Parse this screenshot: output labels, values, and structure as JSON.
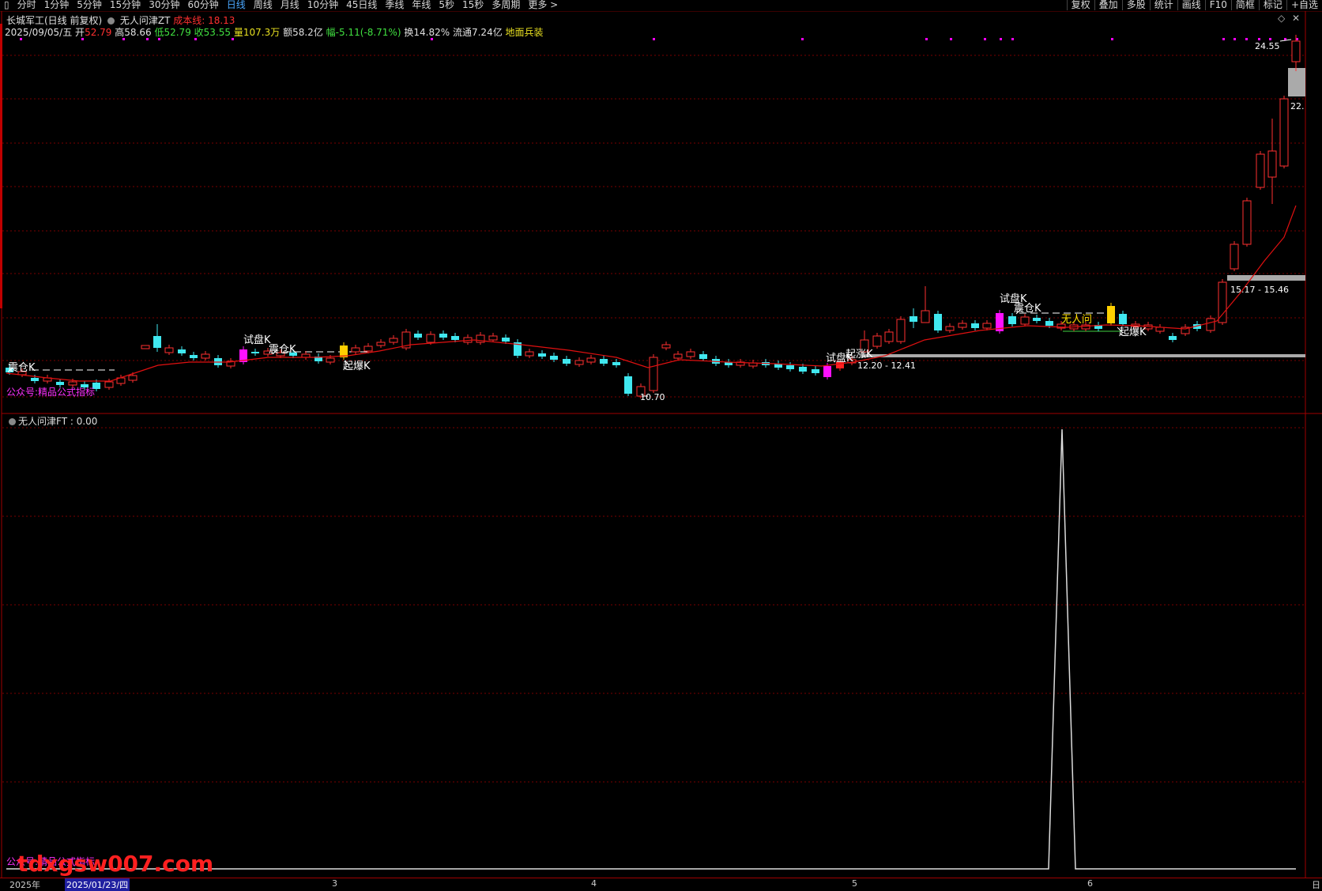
{
  "toolbar": {
    "periods": [
      "分时",
      "1分钟",
      "5分钟",
      "15分钟",
      "30分钟",
      "60分钟",
      "日线",
      "周线",
      "月线",
      "10分钟",
      "45日线",
      "季线",
      "年线",
      "5秒",
      "15秒",
      "多周期",
      "更多 >"
    ],
    "active_period": "日线",
    "right_buttons": [
      "复权",
      "叠加",
      "多股",
      "统计",
      "画线",
      "F10",
      "简框",
      "标记",
      "+自选"
    ]
  },
  "header": {
    "stock_name": "长城军工(日线 前复权)",
    "indicator": "无人问津ZT",
    "cost_line_label": "成本线: 18.13",
    "date": "2025/09/05/五",
    "open_label": "开",
    "open": "52.79",
    "high_label": "高",
    "high": "58.66",
    "low_label": "低",
    "low": "52.79",
    "close_label": "收",
    "close": "53.55",
    "volume_label": "量",
    "volume": "107.3万",
    "amount_label": "额",
    "amount": "58.2亿",
    "change_label": "幅",
    "change": "-5.11(-8.71%)",
    "turnover_label": "换",
    "turnover": "14.82%",
    "float_label": "流通",
    "float": "7.24亿",
    "sector": "地面兵装"
  },
  "annotations": {
    "cangk_1": "震仓K",
    "shipan_1": "试盘K",
    "cangk_2": "震仓K",
    "qibao_1": "起爆K",
    "low_mark": "10.70",
    "shipan_2": "试盘K",
    "qizhang": "起涨K",
    "range_1": "12.20 - 12.41",
    "shipan_3": "试盘K",
    "cangk_3": "震仓K",
    "wurenwen": "无人问",
    "qibao_2": "起爆K",
    "range_2": "15.17 - 15.46",
    "high_mark": "24.55",
    "price_22": "22.",
    "pubtext": "公众号:精品公式指标"
  },
  "lower": {
    "title": "无人问津FT : 0.00",
    "pubtext": "公众号:精品公式指标",
    "watermark": "tdxgsw007.com"
  },
  "axis": {
    "labels": [
      "2025年",
      "2025/01/23/四",
      "3",
      "4",
      "5",
      "6"
    ],
    "right_label": "日"
  },
  "colors": {
    "up": "#ff3030",
    "down": "#40e8f0",
    "ma": "#e01010",
    "grid": "#7a0000",
    "magenta": "#ff00ff",
    "yellow": "#ffd000"
  }
}
